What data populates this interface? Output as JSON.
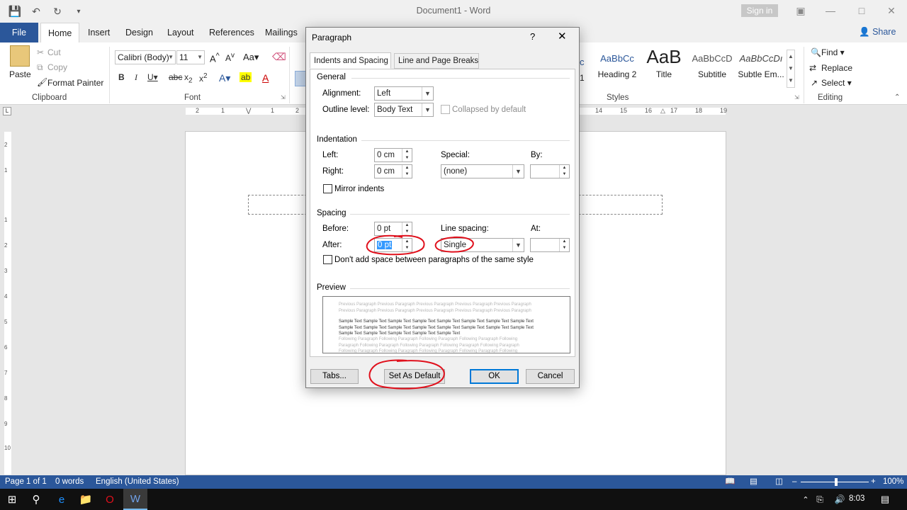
{
  "window": {
    "title": "Document1  -  Word",
    "sign_in": "Sign in",
    "share": "Share"
  },
  "ribbon_tabs": [
    "File",
    "Home",
    "Insert",
    "Design",
    "Layout",
    "References",
    "Mailings"
  ],
  "clipboard": {
    "paste": "Paste",
    "cut": "Cut",
    "copy": "Copy",
    "format_painter": "Format Painter",
    "group_label": "Clipboard"
  },
  "font": {
    "font_name": "Calibri (Body)",
    "font_size": "11",
    "group_label": "Font"
  },
  "styles": {
    "items": [
      {
        "sample": "AaBbCc",
        "name": "Heading 2"
      },
      {
        "sample": "AaB",
        "name": "Title"
      },
      {
        "sample": "AaBbCcD",
        "name": "Subtitle"
      },
      {
        "sample": "AaBbCcDı",
        "name": "Subtle Em..."
      }
    ],
    "partial_label": "1",
    "group_label": "Styles"
  },
  "editing": {
    "find": "Find",
    "replace": "Replace",
    "select": "Select",
    "group_label": "Editing"
  },
  "ruler": {
    "numbers_left": [
      "2",
      "1",
      "1",
      "2"
    ],
    "numbers_right": [
      "14",
      "15",
      "16",
      "17",
      "18",
      "19"
    ],
    "vertical": [
      "2",
      "1",
      "1",
      "2",
      "3",
      "4",
      "5",
      "6",
      "7",
      "8",
      "9",
      "10"
    ]
  },
  "dialog": {
    "title": "Paragraph",
    "help": "?",
    "tabs": [
      "Indents and Spacing",
      "Line and Page Breaks"
    ],
    "general": {
      "section": "General",
      "alignment_label": "Alignment:",
      "alignment_value": "Left",
      "outline_label": "Outline level:",
      "outline_value": "Body Text",
      "collapsed_label": "Collapsed by default"
    },
    "indentation": {
      "section": "Indentation",
      "left_label": "Left:",
      "left_value": "0 cm",
      "right_label": "Right:",
      "right_value": "0 cm",
      "special_label": "Special:",
      "special_value": "(none)",
      "by_label": "By:",
      "mirror_label": "Mirror indents"
    },
    "spacing": {
      "section": "Spacing",
      "before_label": "Before:",
      "before_value": "0 pt",
      "after_label": "After:",
      "after_value": "0 pt",
      "line_spacing_label": "Line spacing:",
      "line_spacing_value": "Single",
      "at_label": "At:",
      "dont_add_label": "Don't add space between paragraphs of the same style"
    },
    "preview": {
      "section": "Preview",
      "previous": "Previous Paragraph Previous Paragraph Previous Paragraph Previous Paragraph Previous Paragraph Previous Paragraph Previous Paragraph Previous Paragraph Previous Paragraph Previous Paragraph",
      "sample": "Sample Text Sample Text Sample Text Sample Text Sample Text Sample Text Sample Text Sample Text Sample Text Sample Text Sample Text Sample Text Sample Text Sample Text Sample Text Sample Text Sample Text Sample Text Sample Text Sample Text Sample Text",
      "following": "Following Paragraph Following Paragraph Following Paragraph Following Paragraph Following Paragraph Following Paragraph Following Paragraph Following Paragraph Following Paragraph Following Paragraph Following Paragraph Following Paragraph Following Paragraph Following Paragraph Following Paragraph"
    },
    "buttons": {
      "tabs": "Tabs...",
      "set_default": "Set As Default",
      "ok": "OK",
      "cancel": "Cancel"
    }
  },
  "status": {
    "page": "Page 1 of 1",
    "words": "0 words",
    "language": "English (United States)",
    "zoom": "100%"
  },
  "taskbar": {
    "time": "8:03"
  },
  "colors": {
    "accent": "#2b579a",
    "annotation": "#e0101c",
    "selection": "#3399ff"
  }
}
